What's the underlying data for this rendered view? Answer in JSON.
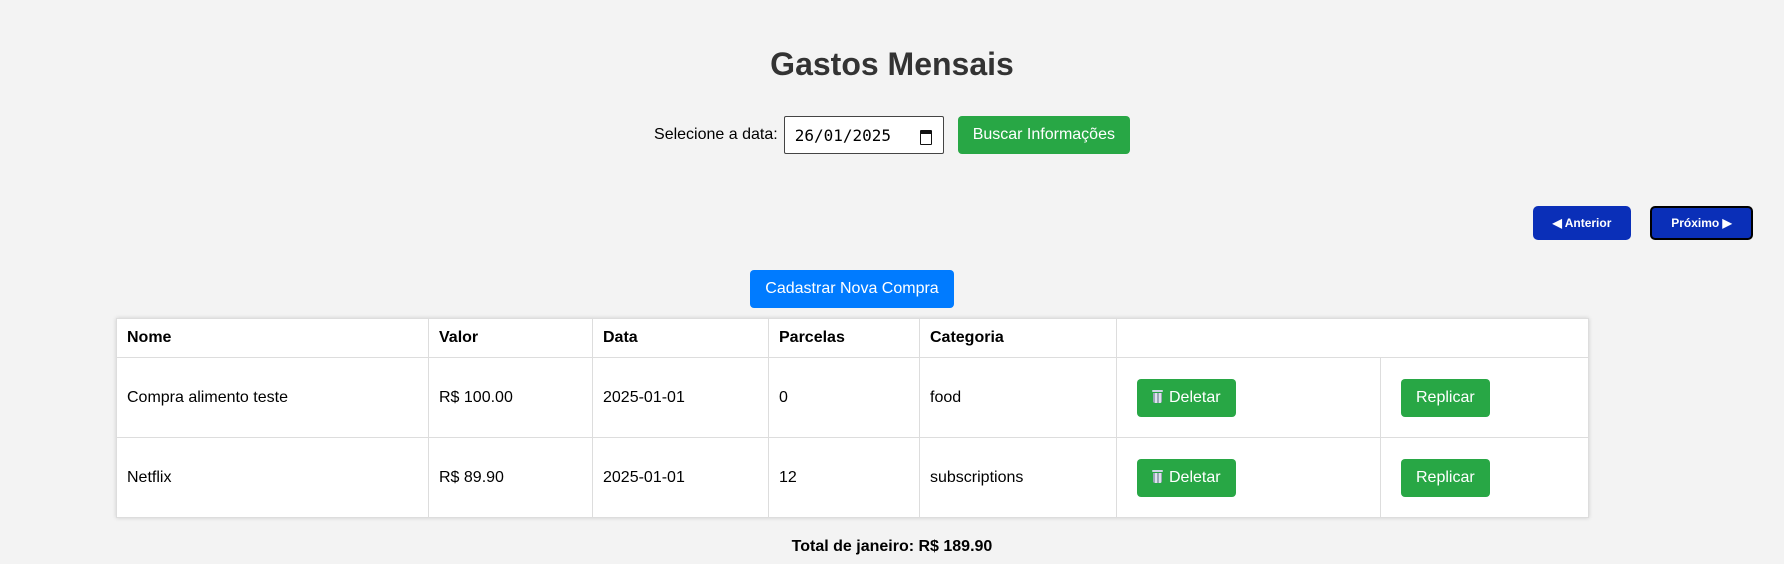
{
  "page": {
    "title": "Gastos Mensais"
  },
  "date_filter": {
    "label": "Selecione a data:",
    "value": "26/01/2025",
    "search_label": "Buscar Informações"
  },
  "navigation": {
    "prev_label": "◀ Anterior",
    "next_label": "Próximo ▶"
  },
  "actions": {
    "new_purchase_label": "Cadastrar Nova Compra"
  },
  "table": {
    "headers": [
      "Nome",
      "Valor",
      "Data",
      "Parcelas",
      "Categoria",
      ""
    ],
    "rows": [
      {
        "nome": "Compra alimento teste",
        "valor": "R$ 100.00",
        "data": "2025-01-01",
        "parcelas": "0",
        "categoria": "food",
        "delete_label": "Deletar",
        "replicate_label": "Replicar"
      },
      {
        "nome": "Netflix",
        "valor": "R$ 89.90",
        "data": "2025-01-01",
        "parcelas": "12",
        "categoria": "subscriptions",
        "delete_label": "Deletar",
        "replicate_label": "Replicar"
      }
    ]
  },
  "total": {
    "text": "Total de janeiro: R$ 189.90"
  },
  "colors": {
    "background": "#f3f3f3",
    "green": "#28a745",
    "blue_primary": "#007bff",
    "nav_blue": "#0a2fb8"
  },
  "icons": {
    "delete": "trash-icon",
    "date": "calendar-icon"
  }
}
